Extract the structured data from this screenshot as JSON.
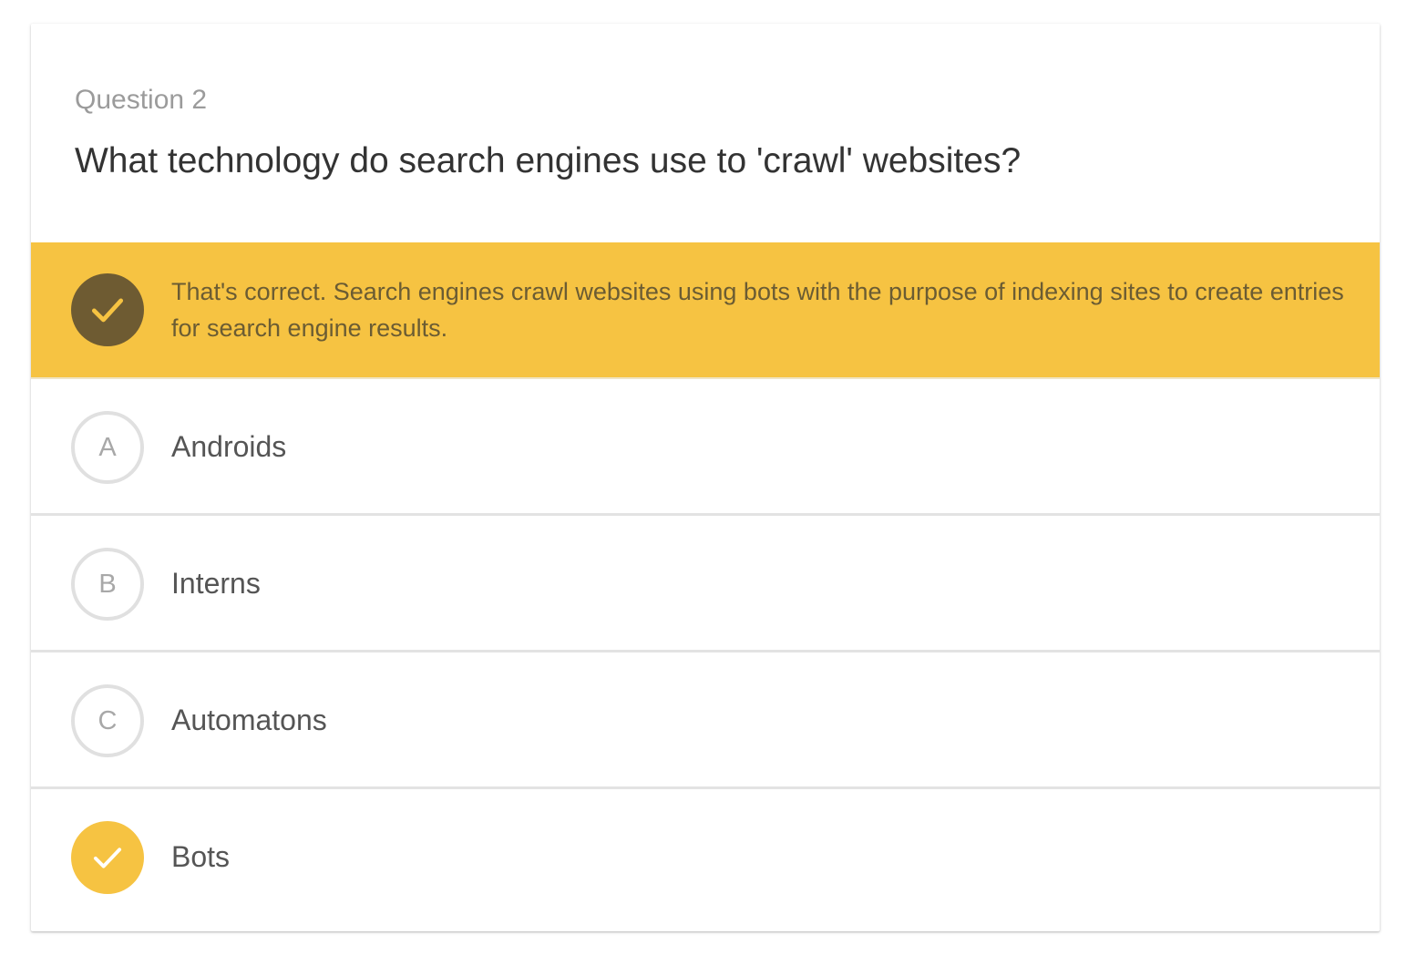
{
  "question": {
    "number_label": "Question 2",
    "text": "What technology do search engines use to 'crawl' websites?"
  },
  "feedback": {
    "status": "correct",
    "icon": "check-icon",
    "text": "That's correct. Search engines crawl websites using bots with the purpose of indexing sites to create entries for search engine results."
  },
  "options": [
    {
      "letter": "A",
      "label": "Androids",
      "selected": false
    },
    {
      "letter": "B",
      "label": "Interns",
      "selected": false
    },
    {
      "letter": "C",
      "label": "Automatons",
      "selected": false
    },
    {
      "letter": "",
      "label": "Bots",
      "selected": true,
      "icon": "check-icon"
    }
  ],
  "colors": {
    "accent": "#f6c342",
    "feedback_icon_bg": "#6e5b32",
    "feedback_text": "#6b5c33",
    "question_text": "#333333",
    "question_number": "#9b9b9b",
    "option_border": "#e0e0e0"
  }
}
